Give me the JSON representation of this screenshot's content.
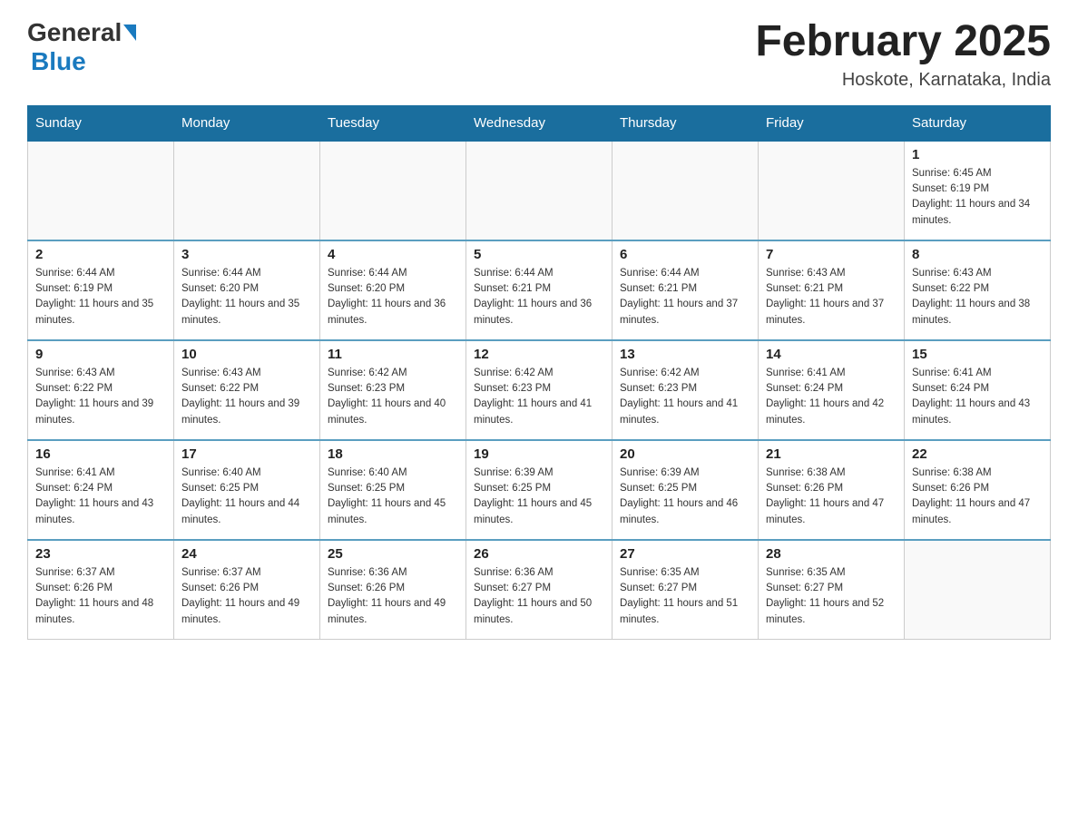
{
  "header": {
    "logo_general": "General",
    "logo_blue": "Blue",
    "title": "February 2025",
    "subtitle": "Hoskote, Karnataka, India"
  },
  "weekdays": [
    "Sunday",
    "Monday",
    "Tuesday",
    "Wednesday",
    "Thursday",
    "Friday",
    "Saturday"
  ],
  "weeks": [
    [
      {
        "day": "",
        "info": ""
      },
      {
        "day": "",
        "info": ""
      },
      {
        "day": "",
        "info": ""
      },
      {
        "day": "",
        "info": ""
      },
      {
        "day": "",
        "info": ""
      },
      {
        "day": "",
        "info": ""
      },
      {
        "day": "1",
        "info": "Sunrise: 6:45 AM\nSunset: 6:19 PM\nDaylight: 11 hours and 34 minutes."
      }
    ],
    [
      {
        "day": "2",
        "info": "Sunrise: 6:44 AM\nSunset: 6:19 PM\nDaylight: 11 hours and 35 minutes."
      },
      {
        "day": "3",
        "info": "Sunrise: 6:44 AM\nSunset: 6:20 PM\nDaylight: 11 hours and 35 minutes."
      },
      {
        "day": "4",
        "info": "Sunrise: 6:44 AM\nSunset: 6:20 PM\nDaylight: 11 hours and 36 minutes."
      },
      {
        "day": "5",
        "info": "Sunrise: 6:44 AM\nSunset: 6:21 PM\nDaylight: 11 hours and 36 minutes."
      },
      {
        "day": "6",
        "info": "Sunrise: 6:44 AM\nSunset: 6:21 PM\nDaylight: 11 hours and 37 minutes."
      },
      {
        "day": "7",
        "info": "Sunrise: 6:43 AM\nSunset: 6:21 PM\nDaylight: 11 hours and 37 minutes."
      },
      {
        "day": "8",
        "info": "Sunrise: 6:43 AM\nSunset: 6:22 PM\nDaylight: 11 hours and 38 minutes."
      }
    ],
    [
      {
        "day": "9",
        "info": "Sunrise: 6:43 AM\nSunset: 6:22 PM\nDaylight: 11 hours and 39 minutes."
      },
      {
        "day": "10",
        "info": "Sunrise: 6:43 AM\nSunset: 6:22 PM\nDaylight: 11 hours and 39 minutes."
      },
      {
        "day": "11",
        "info": "Sunrise: 6:42 AM\nSunset: 6:23 PM\nDaylight: 11 hours and 40 minutes."
      },
      {
        "day": "12",
        "info": "Sunrise: 6:42 AM\nSunset: 6:23 PM\nDaylight: 11 hours and 41 minutes."
      },
      {
        "day": "13",
        "info": "Sunrise: 6:42 AM\nSunset: 6:23 PM\nDaylight: 11 hours and 41 minutes."
      },
      {
        "day": "14",
        "info": "Sunrise: 6:41 AM\nSunset: 6:24 PM\nDaylight: 11 hours and 42 minutes."
      },
      {
        "day": "15",
        "info": "Sunrise: 6:41 AM\nSunset: 6:24 PM\nDaylight: 11 hours and 43 minutes."
      }
    ],
    [
      {
        "day": "16",
        "info": "Sunrise: 6:41 AM\nSunset: 6:24 PM\nDaylight: 11 hours and 43 minutes."
      },
      {
        "day": "17",
        "info": "Sunrise: 6:40 AM\nSunset: 6:25 PM\nDaylight: 11 hours and 44 minutes."
      },
      {
        "day": "18",
        "info": "Sunrise: 6:40 AM\nSunset: 6:25 PM\nDaylight: 11 hours and 45 minutes."
      },
      {
        "day": "19",
        "info": "Sunrise: 6:39 AM\nSunset: 6:25 PM\nDaylight: 11 hours and 45 minutes."
      },
      {
        "day": "20",
        "info": "Sunrise: 6:39 AM\nSunset: 6:25 PM\nDaylight: 11 hours and 46 minutes."
      },
      {
        "day": "21",
        "info": "Sunrise: 6:38 AM\nSunset: 6:26 PM\nDaylight: 11 hours and 47 minutes."
      },
      {
        "day": "22",
        "info": "Sunrise: 6:38 AM\nSunset: 6:26 PM\nDaylight: 11 hours and 47 minutes."
      }
    ],
    [
      {
        "day": "23",
        "info": "Sunrise: 6:37 AM\nSunset: 6:26 PM\nDaylight: 11 hours and 48 minutes."
      },
      {
        "day": "24",
        "info": "Sunrise: 6:37 AM\nSunset: 6:26 PM\nDaylight: 11 hours and 49 minutes."
      },
      {
        "day": "25",
        "info": "Sunrise: 6:36 AM\nSunset: 6:26 PM\nDaylight: 11 hours and 49 minutes."
      },
      {
        "day": "26",
        "info": "Sunrise: 6:36 AM\nSunset: 6:27 PM\nDaylight: 11 hours and 50 minutes."
      },
      {
        "day": "27",
        "info": "Sunrise: 6:35 AM\nSunset: 6:27 PM\nDaylight: 11 hours and 51 minutes."
      },
      {
        "day": "28",
        "info": "Sunrise: 6:35 AM\nSunset: 6:27 PM\nDaylight: 11 hours and 52 minutes."
      },
      {
        "day": "",
        "info": ""
      }
    ]
  ]
}
